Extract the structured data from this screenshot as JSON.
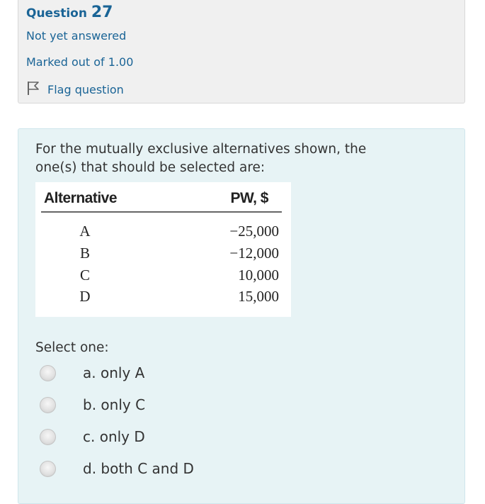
{
  "info": {
    "question_label": "Question",
    "question_number": "27",
    "state": "Not yet answered",
    "grade": "Marked out of 1.00",
    "flag_label": "Flag question"
  },
  "question": {
    "text": "For the mutually exclusive alternatives shown, the one(s) that should be selected are:",
    "table": {
      "headers": [
        "Alternative",
        "PW, $"
      ],
      "rows": [
        {
          "alt": "A",
          "pw": "−25,000"
        },
        {
          "alt": "B",
          "pw": "−12,000"
        },
        {
          "alt": "C",
          "pw": "10,000"
        },
        {
          "alt": "D",
          "pw": "15,000"
        }
      ]
    },
    "prompt": "Select one:",
    "options": [
      {
        "label": "a. only A"
      },
      {
        "label": "b. only C"
      },
      {
        "label": "c. only D"
      },
      {
        "label": "d. both C and D"
      }
    ]
  },
  "colors": {
    "link_blue": "#1a6496",
    "info_bg": "#f0f0f0",
    "formulation_bg": "#e7f3f5"
  },
  "icons": {
    "flag": "flag-icon"
  }
}
